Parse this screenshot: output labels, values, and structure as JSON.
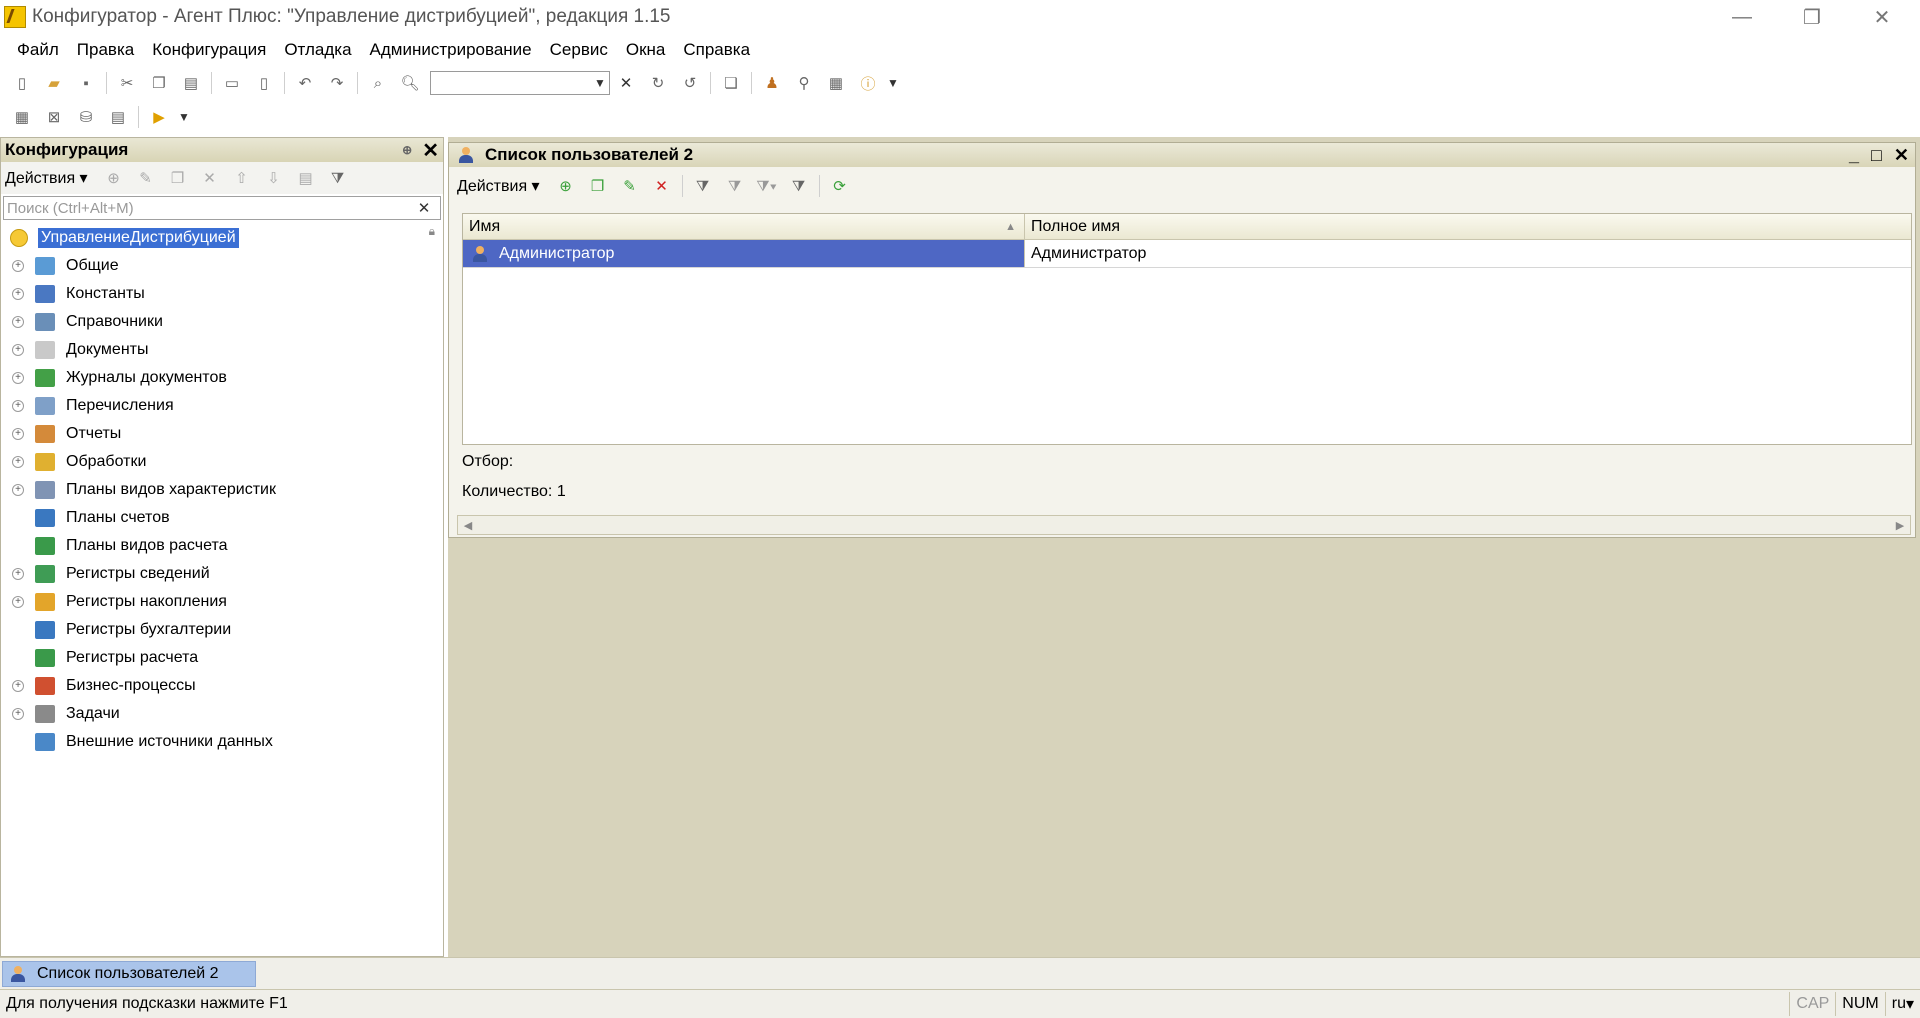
{
  "window": {
    "title": "Конфигуратор - Агент Плюс: \"Управление дистрибуцией\", редакция 1.15",
    "minimize_glyph": "—",
    "restore_glyph": "❐",
    "close_glyph": "✕"
  },
  "menu": [
    {
      "label": "Файл"
    },
    {
      "label": "Правка"
    },
    {
      "label": "Конфигурация"
    },
    {
      "label": "Отладка"
    },
    {
      "label": "Администрирование"
    },
    {
      "label": "Сервис"
    },
    {
      "label": "Окна"
    },
    {
      "label": "Справка"
    }
  ],
  "toolbar": {
    "search_value": ""
  },
  "left_panel": {
    "title": "Конфигурация",
    "actions_label": "Действия",
    "search_placeholder": "Поиск (Ctrl+Alt+M)",
    "root": "УправлениеДистрибуцией",
    "items": [
      {
        "label": "Общие",
        "expandable": true,
        "icon": "common-icon",
        "color": "#5a9bd5"
      },
      {
        "label": "Константы",
        "expandable": true,
        "icon": "constants-icon",
        "color": "#4a78c2"
      },
      {
        "label": "Справочники",
        "expandable": true,
        "icon": "catalogs-icon",
        "color": "#6a8fb8"
      },
      {
        "label": "Документы",
        "expandable": true,
        "icon": "documents-icon",
        "color": "#c9c9c9"
      },
      {
        "label": "Журналы документов",
        "expandable": true,
        "icon": "journals-icon",
        "color": "#43a047"
      },
      {
        "label": "Перечисления",
        "expandable": true,
        "icon": "enums-icon",
        "color": "#7fa0c8"
      },
      {
        "label": "Отчеты",
        "expandable": true,
        "icon": "reports-icon",
        "color": "#d48a3a"
      },
      {
        "label": "Обработки",
        "expandable": true,
        "icon": "dataprocessors-icon",
        "color": "#e0b030"
      },
      {
        "label": "Планы видов характеристик",
        "expandable": true,
        "icon": "chartsofcharacteristics-icon",
        "color": "#8094b4"
      },
      {
        "label": "Планы счетов",
        "expandable": false,
        "icon": "chartsofaccounts-icon",
        "color": "#3a78c0"
      },
      {
        "label": "Планы видов расчета",
        "expandable": false,
        "icon": "chartsofcalculation-icon",
        "color": "#3a9a4a"
      },
      {
        "label": "Регистры сведений",
        "expandable": true,
        "icon": "inforegisters-icon",
        "color": "#3f9c55"
      },
      {
        "label": "Регистры накопления",
        "expandable": true,
        "icon": "accumregisters-icon",
        "color": "#e3a52a"
      },
      {
        "label": "Регистры бухгалтерии",
        "expandable": false,
        "icon": "accountingregisters-icon",
        "color": "#3a78c0"
      },
      {
        "label": "Регистры расчета",
        "expandable": false,
        "icon": "calcregisters-icon",
        "color": "#3a9a4a"
      },
      {
        "label": "Бизнес-процессы",
        "expandable": true,
        "icon": "businessprocesses-icon",
        "color": "#d05030"
      },
      {
        "label": "Задачи",
        "expandable": true,
        "icon": "tasks-icon",
        "color": "#8a8a8a"
      },
      {
        "label": "Внешние источники данных",
        "expandable": false,
        "icon": "externaldatasources-icon",
        "color": "#4a88c8"
      }
    ]
  },
  "user_list": {
    "title": "Список пользователей 2",
    "actions_label": "Действия",
    "columns": [
      "Имя",
      "Полное имя"
    ],
    "rows": [
      {
        "name": "Администратор",
        "full_name": "Администратор"
      }
    ],
    "filter_label": "Отбор:",
    "count_label": "Количество: 1"
  },
  "windows_bar": {
    "tab_label": "Список пользователей 2"
  },
  "status": {
    "hint": "Для получения подсказки нажмите F1",
    "cap": "CAP",
    "num": "NUM",
    "lang": "ru"
  }
}
